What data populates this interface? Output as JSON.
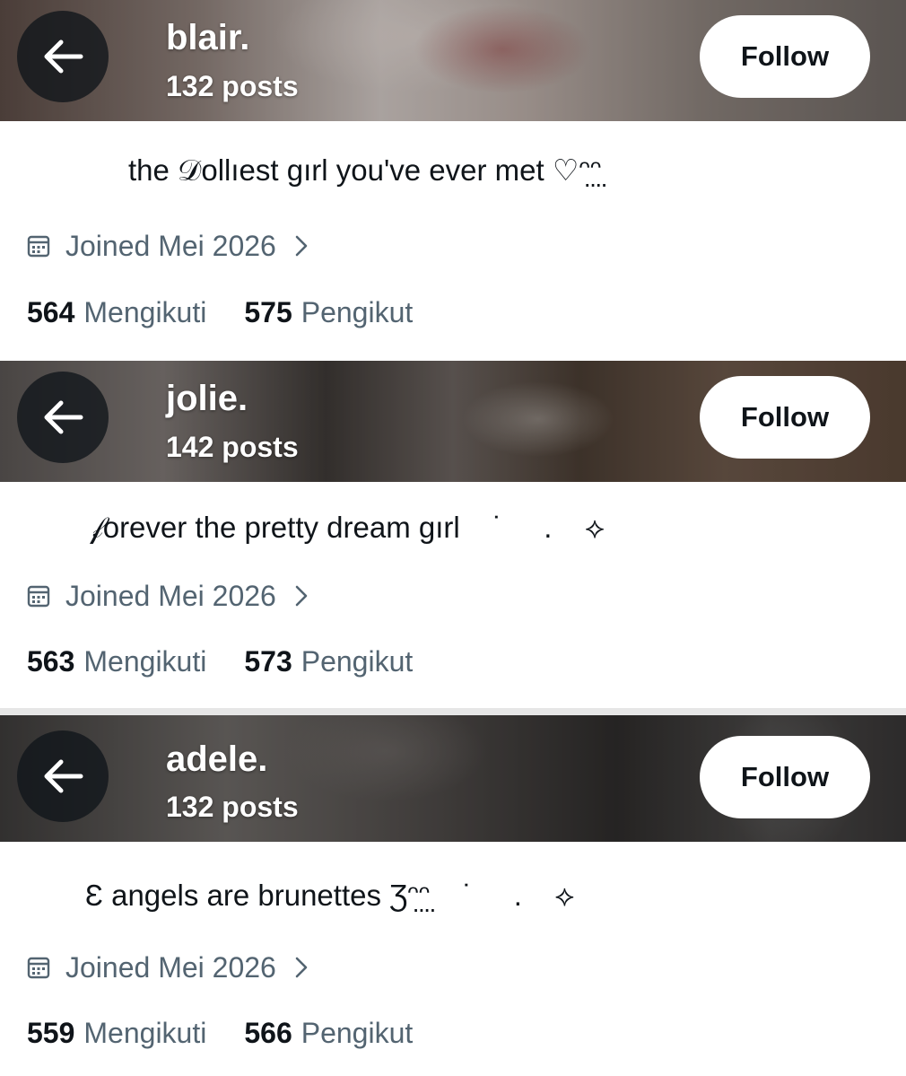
{
  "profiles": [
    {
      "name": "blair.",
      "posts": "132 posts",
      "follow_label": "Follow",
      "bio": "the 𝒟ollıest gırl you've ever met ♡ᵔ̤ᵔ̤",
      "joined": "Joined Mei 2026",
      "following_count": "564",
      "following_label": "Mengikuti",
      "followers_count": "575",
      "followers_label": "Pengikut"
    },
    {
      "name": "jolie.",
      "posts": "142 posts",
      "follow_label": "Follow",
      "bio": "𝒻orever the pretty dream gırl    ˙     .    ⟡",
      "joined": "Joined Mei 2026",
      "following_count": "563",
      "following_label": "Mengikuti",
      "followers_count": "573",
      "followers_label": "Pengikut"
    },
    {
      "name": "adele.",
      "posts": "132 posts",
      "follow_label": "Follow",
      "bio": "Ɛ angels are brunettes Ʒᵔ̤ᵔ̤    ˙     .    ⟡",
      "joined": "Joined Mei 2026",
      "following_count": "559",
      "following_label": "Mengikuti",
      "followers_count": "566",
      "followers_label": "Pengikut"
    }
  ],
  "icons": {
    "back": "arrow-left-icon",
    "calendar": "calendar-icon",
    "chevron": "chevron-right-icon"
  },
  "colors": {
    "text_primary": "#0f1419",
    "text_secondary": "#536471",
    "button_bg": "#ffffff"
  }
}
